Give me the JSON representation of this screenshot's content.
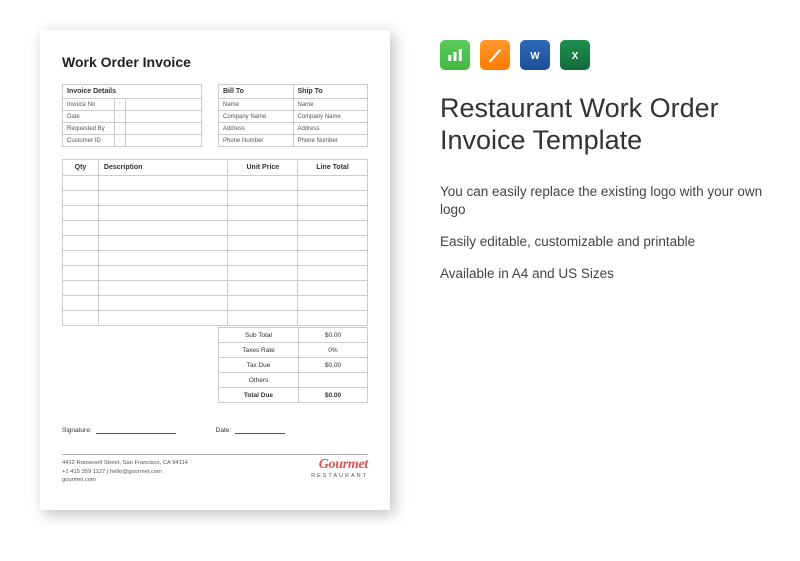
{
  "doc": {
    "title": "Work Order Invoice",
    "details": {
      "header": "Invoice Details",
      "rows": [
        {
          "label": "Invoice No",
          "colon": ":"
        },
        {
          "label": "Date",
          "colon": ":"
        },
        {
          "label": "Requested By",
          "colon": ":"
        },
        {
          "label": "Customer ID",
          "colon": ":"
        }
      ]
    },
    "billship": {
      "bill_header": "Bill To",
      "ship_header": "Ship To",
      "rows": [
        {
          "bill": "Name",
          "ship": "Name"
        },
        {
          "bill": "Company Name",
          "ship": "Company Name"
        },
        {
          "bill": "Address",
          "ship": "Address"
        },
        {
          "bill": "Phone Number",
          "ship": "Phone Number"
        }
      ]
    },
    "main_headers": {
      "qty": "Qty",
      "desc": "Description",
      "up": "Unit Price",
      "lt": "Line Total"
    },
    "totals": [
      {
        "label": "Sub Total",
        "value": "$0.00"
      },
      {
        "label": "Taxes Rate",
        "value": "0%"
      },
      {
        "label": "Tax Due",
        "value": "$0.00"
      },
      {
        "label": "Others",
        "value": ""
      },
      {
        "label": "Total Due",
        "value": "$0.00"
      }
    ],
    "sign": {
      "signature": "Signature:",
      "date": "Date:"
    },
    "footer": {
      "line1": "4412 Roosevelt Street, San Francisco, CA 94114",
      "line2": "+1 415 359 1127 | hello@gourmet.com",
      "line3": "gourmet.com"
    },
    "brand": {
      "name": "Gourmet",
      "sub": "RESTAURANT"
    }
  },
  "right": {
    "icons": [
      "numbers",
      "pages",
      "word",
      "excel"
    ],
    "heading_l1": "Restaurant Work Order",
    "heading_l2": "Invoice Template",
    "features": [
      "You can easily replace the existing logo with your own logo",
      "Easily editable, customizable and printable",
      "Available in A4 and US Sizes"
    ]
  }
}
